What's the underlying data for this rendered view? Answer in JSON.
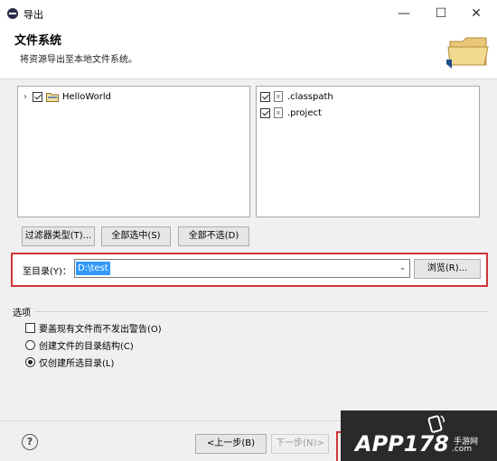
{
  "window": {
    "title": "导出",
    "minimize": "—",
    "maximize": "☐",
    "close": "✕"
  },
  "header": {
    "title": "文件系统",
    "description": "将资源导出至本地文件系统。"
  },
  "left_tree": [
    {
      "label": "HelloWorld",
      "checked": true,
      "expandable": true
    }
  ],
  "right_list": [
    {
      "label": ".classpath",
      "checked": true
    },
    {
      "label": ".project",
      "checked": true
    }
  ],
  "buttons": {
    "filter": "过滤器类型(T)...",
    "select_all": "全部选中(S)",
    "deselect_all": "全部不选(D)",
    "browse": "浏览(R)...",
    "back": "<上一步(B)",
    "next": "下一步(N)>"
  },
  "destination": {
    "label": "至目录(Y)：",
    "value": "D:\\test"
  },
  "options": {
    "title": "选项",
    "overwrite": "要盖现有文件而不发出警告(O)",
    "create_dir_structure": "创建文件的目录结构(C)",
    "create_selected_only": "仅创建所选目录(L)",
    "selected": "create_selected_only"
  },
  "help": "?",
  "watermark": {
    "text": "APP178",
    "sub": "手游网",
    "url": ".com"
  }
}
